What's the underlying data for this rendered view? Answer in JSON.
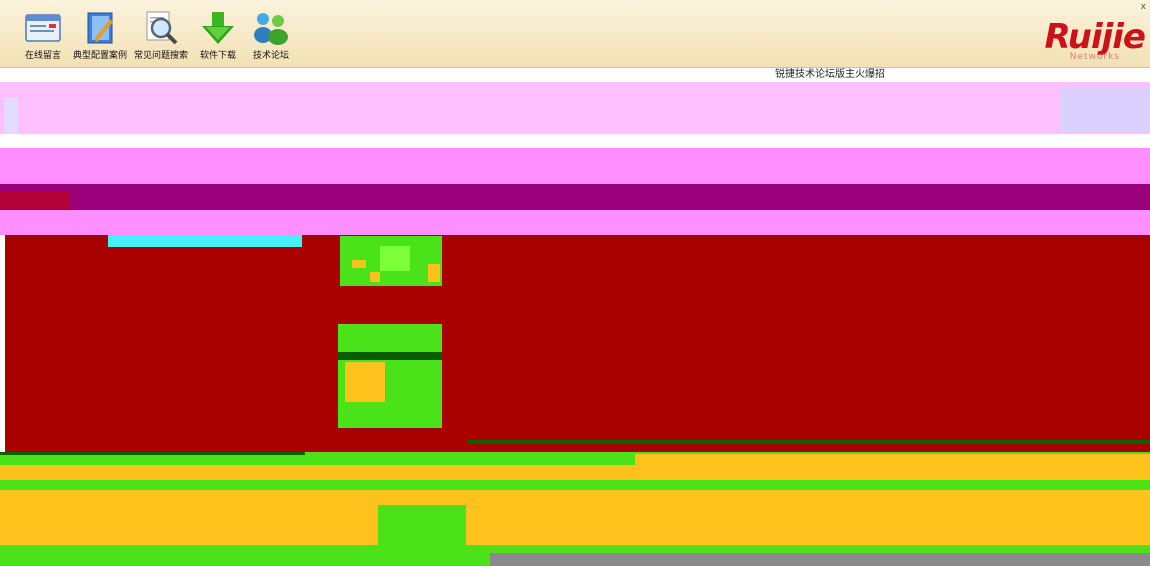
{
  "toolbar": {
    "items": [
      {
        "label": "在线留言",
        "icon": "message-board-icon"
      },
      {
        "label": "典型配置案例",
        "icon": "config-case-book-icon"
      },
      {
        "label": "常见问题搜索",
        "icon": "faq-search-icon"
      },
      {
        "label": "软件下载",
        "icon": "download-arrow-icon"
      },
      {
        "label": "技术论坛",
        "icon": "forum-users-icon"
      }
    ]
  },
  "brand": {
    "logo_text": "Ruijie",
    "sub_text": "Networks",
    "color": "#cc1219"
  },
  "notice": {
    "text": "锐捷技术论坛版主火爆招"
  },
  "colors": {
    "toolbar_bg": "#f2e1b4",
    "glitch_pink": "#ff8eff",
    "glitch_purple": "#9b007b",
    "glitch_red": "#a90000",
    "glitch_green": "#4ae31a",
    "glitch_yellow": "#ffc21c",
    "glitch_cyan": "#46f0ff"
  }
}
